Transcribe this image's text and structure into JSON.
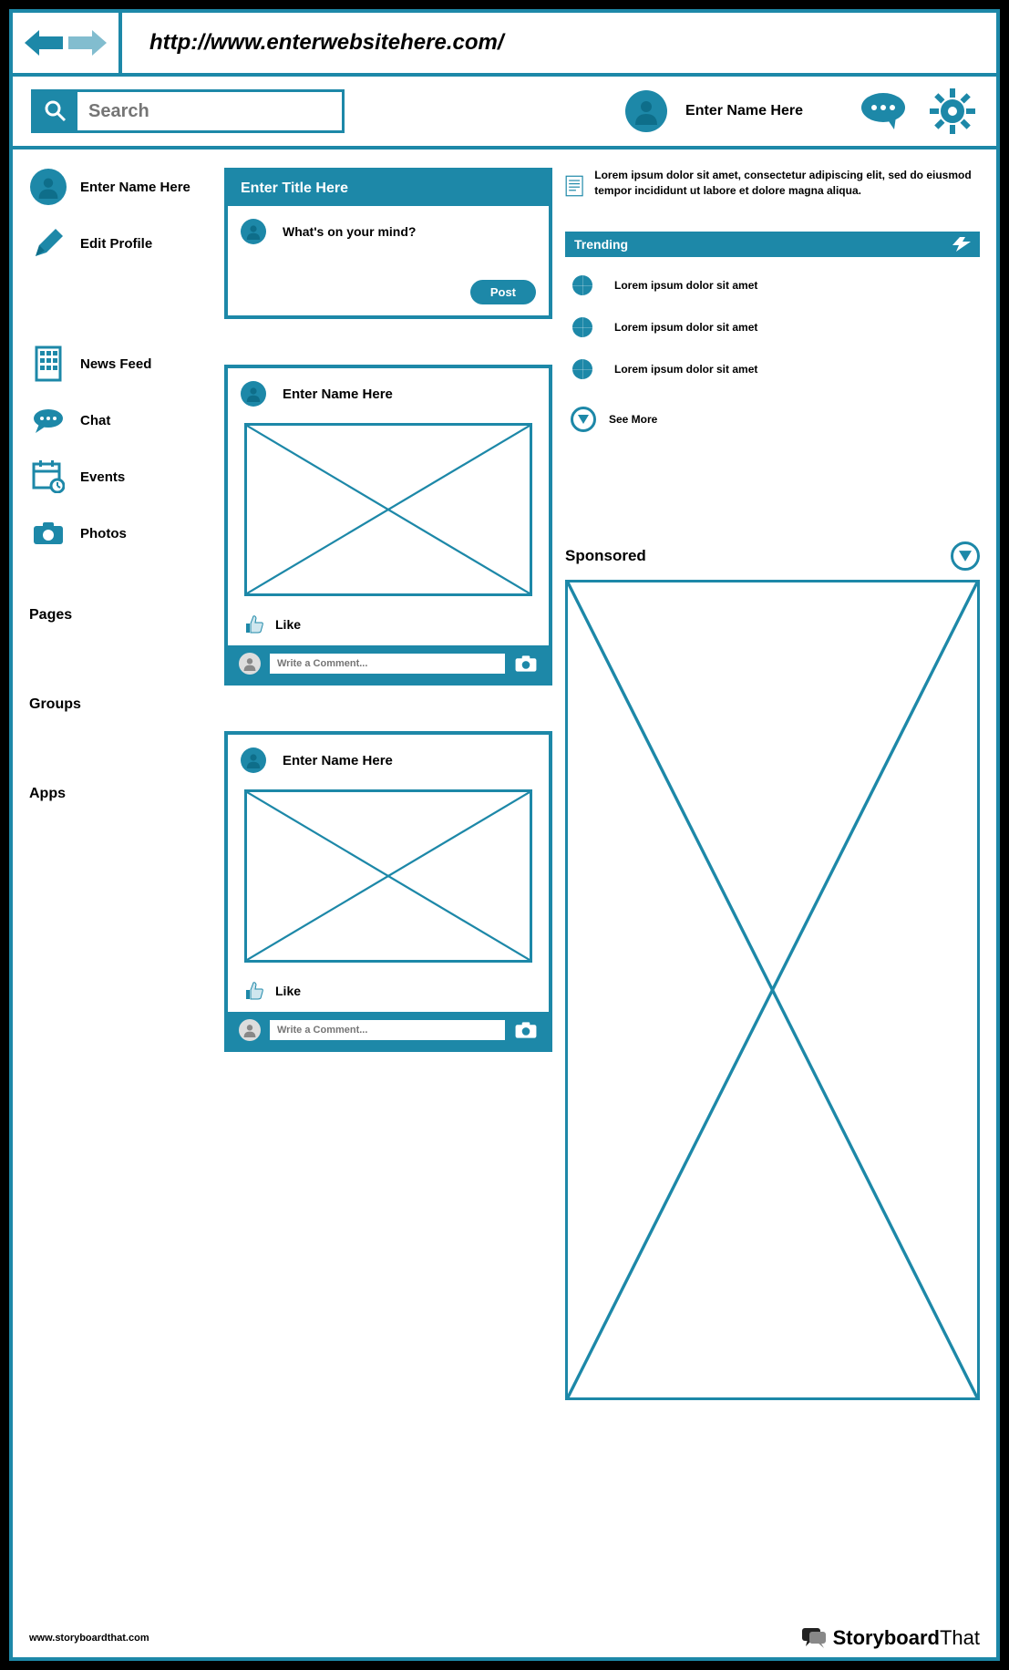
{
  "url": "http://www.enterwebsitehere.com/",
  "search": {
    "placeholder": "Search"
  },
  "header": {
    "user_name": "Enter Name Here"
  },
  "sidebar": {
    "user_name": "Enter Name Here",
    "edit_profile": "Edit Profile",
    "nav": [
      {
        "label": "News Feed"
      },
      {
        "label": "Chat"
      },
      {
        "label": "Events"
      },
      {
        "label": "Photos"
      }
    ],
    "sections": [
      {
        "label": "Pages"
      },
      {
        "label": "Groups"
      },
      {
        "label": "Apps"
      }
    ]
  },
  "compose": {
    "title": "Enter Title Here",
    "prompt": "What's on your mind?",
    "post_label": "Post"
  },
  "posts": [
    {
      "author": "Enter Name Here",
      "like_label": "Like",
      "comment_placeholder": "Write a Comment..."
    },
    {
      "author": "Enter Name Here",
      "like_label": "Like",
      "comment_placeholder": "Write a Comment..."
    }
  ],
  "info": {
    "text": "Lorem ipsum dolor sit amet, consectetur adipiscing elit, sed do eiusmod tempor incididunt ut labore et dolore magna aliqua."
  },
  "trending": {
    "title": "Trending",
    "items": [
      {
        "text": "Lorem ipsum dolor sit amet"
      },
      {
        "text": "Lorem ipsum dolor sit amet"
      },
      {
        "text": "Lorem ipsum dolor sit amet"
      }
    ],
    "see_more": "See More"
  },
  "sponsored": {
    "title": "Sponsored"
  },
  "footer": {
    "url": "www.storyboardthat.com",
    "brand_bold": "Storyboard",
    "brand_light": "That"
  }
}
